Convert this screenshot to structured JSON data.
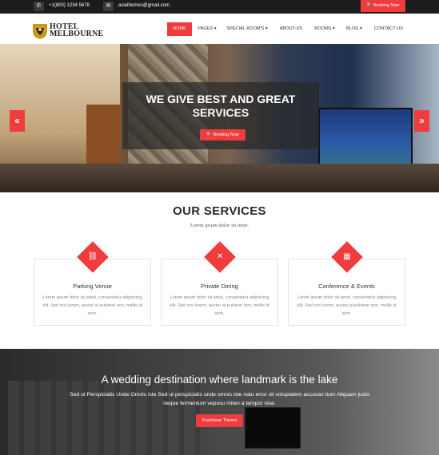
{
  "topbar": {
    "phone_icon": "phone-icon",
    "phone": "+1(800) 1234 5678",
    "email_icon": "envelope-icon",
    "email": "asiathemes@gmail.com",
    "booking_label": "Booking Now"
  },
  "logo": {
    "line1": "HOTEL",
    "line2": "MELBOURNE"
  },
  "nav": {
    "items": [
      {
        "label": "HOME"
      },
      {
        "label": "PAGES ▾"
      },
      {
        "label": "SPECIAL ROOM'S ▾"
      },
      {
        "label": "ABOUT-US"
      },
      {
        "label": "ROOMS ▾"
      },
      {
        "label": "BLOG ▾"
      },
      {
        "label": "CONTACT-US"
      }
    ]
  },
  "hero": {
    "title": "WE GIVE BEST AND GREAT SERVICES",
    "button": "Booking Now",
    "prev": "«",
    "next": "»"
  },
  "services": {
    "title": "OUR SERVICES",
    "subtitle": "Lorem ipsum dolor sit amet.",
    "cards": [
      {
        "icon": "car-icon",
        "glyph": "🚘",
        "title": "Parking Venue",
        "text": "Lorem ipsum dolor sit amet, consectetur adipiscing elit. Sed orci lorem, auctor at pulvinar non, mollis id sem."
      },
      {
        "icon": "fork-knife-icon",
        "glyph": "🍴",
        "title": "Private Dining",
        "text": "Lorem ipsum dolor sit amet, consectetur adipiscing elit. Sed orci lorem, auctor at pulvinar non, mollis id sem."
      },
      {
        "icon": "calendar-icon",
        "glyph": "📅",
        "title": "Conference & Events",
        "text": "Lorem ipsum dolor sit amet, consectetur adipiscing elit. Sed orci lorem, auctor at pulvinar non, mollis id sem."
      }
    ]
  },
  "promo": {
    "title": "A wedding destination where landmark is the lake",
    "text": "Sed ut Perspiciatis Unde Omnis iste Sed ut perspiciatis unde omnis iste natu error sit voluptatem accusan tium Aliquam justo neque fermentum veposu miten a tempor nise.",
    "button": "Purchase Theme"
  },
  "colors": {
    "accent": "#f03c3c",
    "topbar": "#1c1c1c"
  }
}
